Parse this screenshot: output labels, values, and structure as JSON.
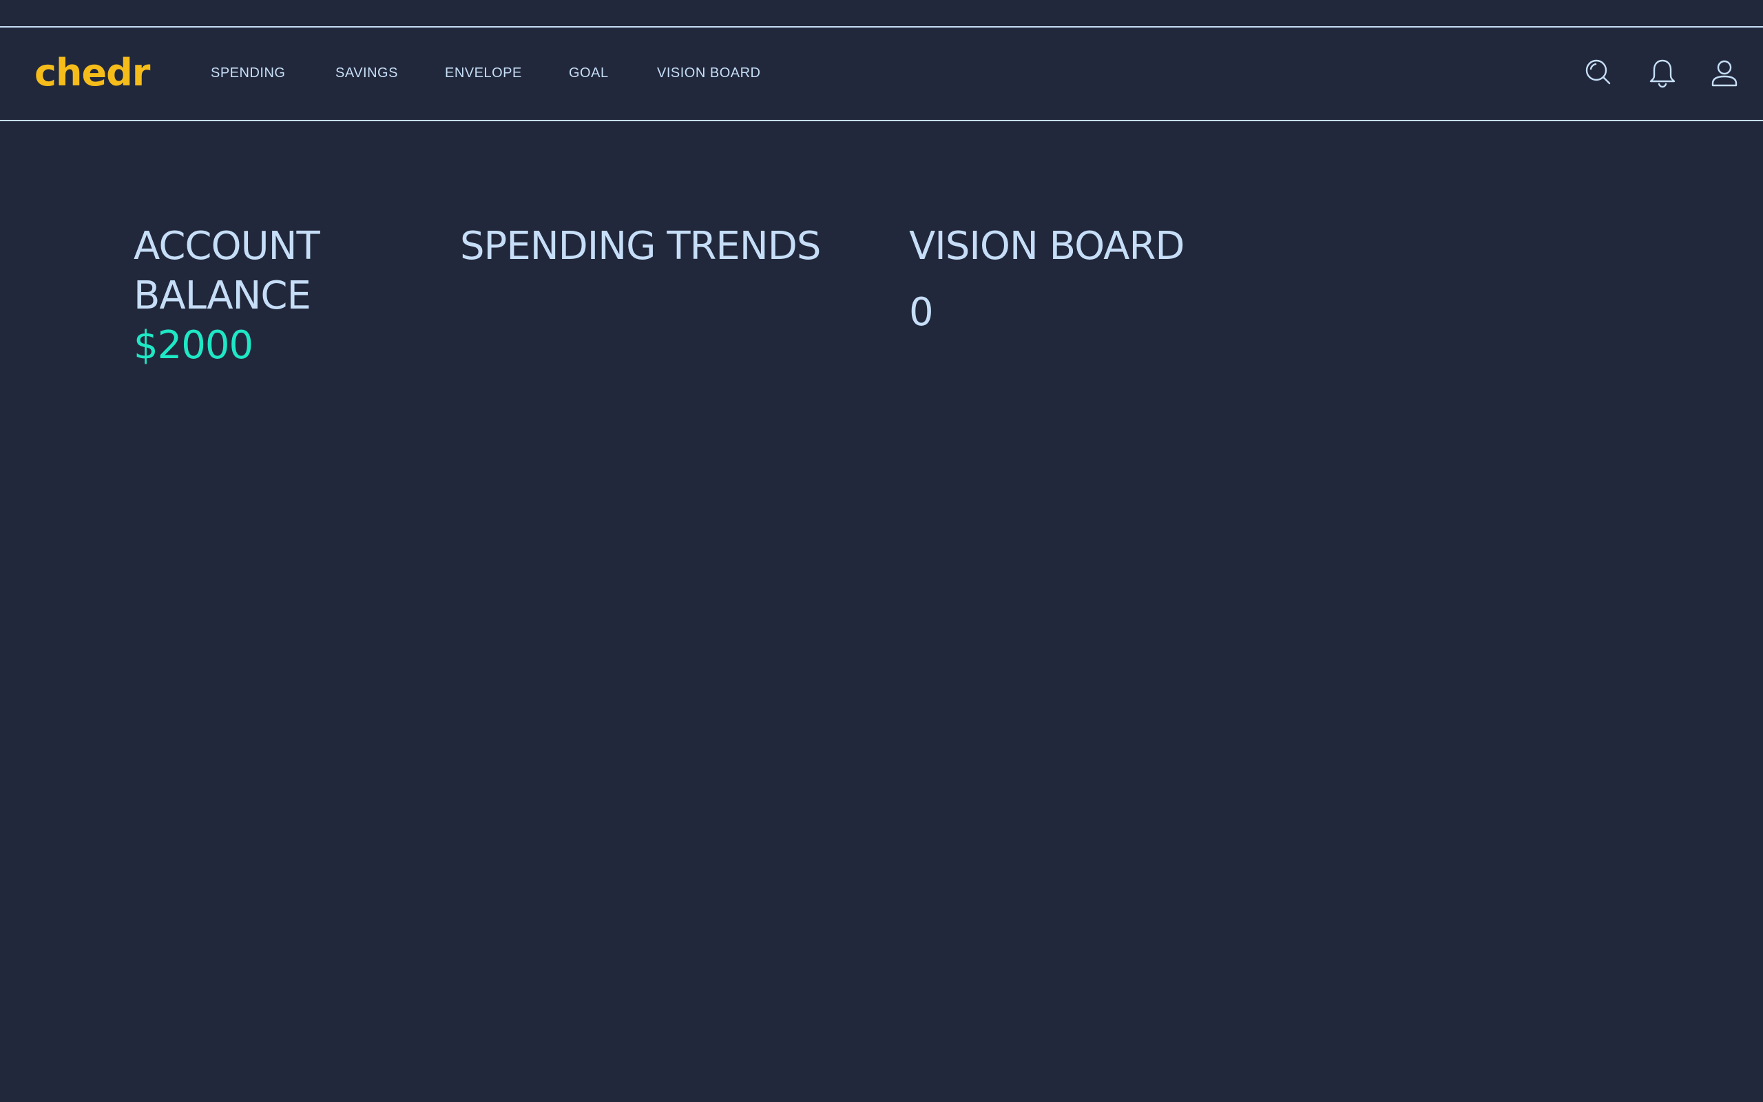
{
  "header": {
    "logo": "chedr",
    "nav": [
      {
        "label": "SPENDING"
      },
      {
        "label": "SAVINGS"
      },
      {
        "label": "ENVELOPE"
      },
      {
        "label": "GOAL"
      },
      {
        "label": "VISION BOARD"
      }
    ],
    "icons": [
      "search-icon",
      "bell-icon",
      "user-icon"
    ]
  },
  "main": {
    "account_balance": {
      "title": "ACCOUNT BALANCE",
      "value": "$2000"
    },
    "spending_trends": {
      "title": "SPENDING TRENDS"
    },
    "vision_board": {
      "title": "VISION BOARD",
      "count": "0"
    }
  },
  "colors": {
    "background": "#22283b",
    "text": "#c6def7",
    "logo": "#f6bd1a",
    "balance": "#1ee8c5"
  }
}
